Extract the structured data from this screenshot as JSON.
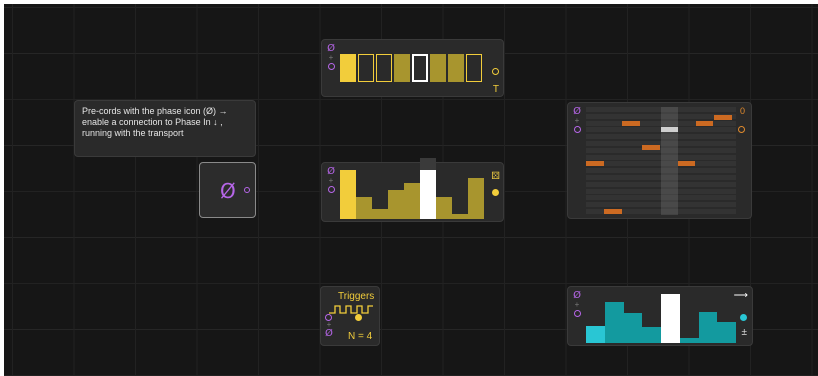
{
  "tooltip": {
    "line1": "Pre-cords with the phase icon  (Ø) →",
    "line2": "enable a connection to Phase In   ↓ ,",
    "line3": "running with the transport"
  },
  "glyphs": {
    "phase": "Ø",
    "plus": "+"
  },
  "step_module": {
    "label": "T",
    "steps": [
      "fill",
      "outline",
      "outline",
      "dim",
      "active",
      "dim",
      "dim",
      "outline"
    ],
    "accent": "#f2cd3b"
  },
  "bar_module": {
    "values": [
      0.95,
      0.42,
      0.2,
      0.55,
      0.7,
      0.95,
      0.42,
      0.1,
      0.78
    ],
    "active_index": 5,
    "accent": "#f2cd3b",
    "dim": "#a8952e",
    "side_icon": "dice-icon"
  },
  "roll_module": {
    "top_value": "0",
    "accent": "#e08a2d"
  },
  "triggers": {
    "title": "Triggers",
    "count_label": "N = 4"
  },
  "teal_module": {
    "values": [
      0.33,
      0.78,
      0.58,
      0.3,
      0.95,
      0.1,
      0.6,
      0.4
    ],
    "active_index": 4,
    "accent": "#29c6d4",
    "dim": "#139a9f",
    "plusminus": "±",
    "arrow": "⟶"
  }
}
